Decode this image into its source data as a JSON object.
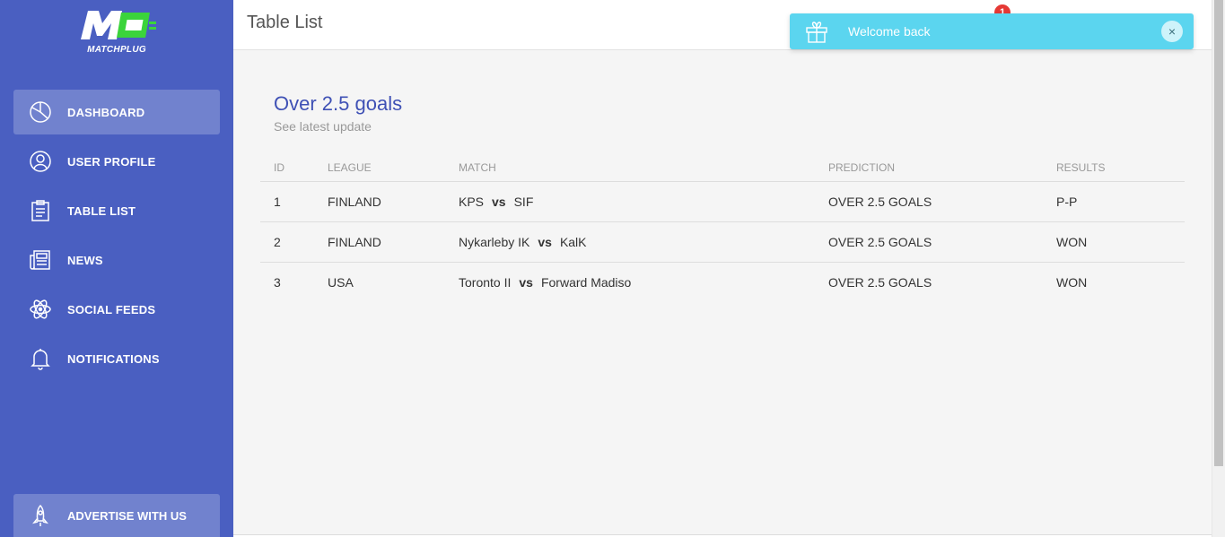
{
  "app": {
    "logo_text": "MATCHPLUG",
    "colors": {
      "sidebar": "#4a5fc1",
      "accent": "#3f51b5",
      "toast": "#5bd5ef",
      "logo_green": "#3bd43b",
      "badge": "#e53935"
    }
  },
  "sidebar": {
    "items": [
      {
        "label": "DASHBOARD",
        "icon": "pie-chart-icon",
        "active": true
      },
      {
        "label": "USER PROFILE",
        "icon": "user-circle-icon",
        "active": false
      },
      {
        "label": "TABLE LIST",
        "icon": "clipboard-icon",
        "active": false
      },
      {
        "label": "NEWS",
        "icon": "newspaper-icon",
        "active": false
      },
      {
        "label": "SOCIAL FEEDS",
        "icon": "atom-icon",
        "active": false
      },
      {
        "label": "NOTIFICATIONS",
        "icon": "bell-icon",
        "active": false
      }
    ],
    "advertise": {
      "label": "ADVERTISE WITH US",
      "icon": "rocket-icon"
    }
  },
  "header": {
    "title": "Table List",
    "notification_count": "1"
  },
  "toast": {
    "message": "Welcome back",
    "icon": "gift-icon",
    "close_symbol": "×"
  },
  "card": {
    "title": "Over 2.5 goals",
    "subtitle": "See latest update",
    "columns": [
      "ID",
      "LEAGUE",
      "MATCH",
      "PREDICTION",
      "RESULTS"
    ],
    "vs_label": "vs",
    "rows": [
      {
        "id": "1",
        "league": "FINLAND",
        "home": "KPS",
        "away": "SIF",
        "prediction": "OVER 2.5 GOALS",
        "result": "P-P"
      },
      {
        "id": "2",
        "league": "FINLAND",
        "home": "Nykarleby IK",
        "away": "KalK",
        "prediction": "OVER 2.5 GOALS",
        "result": "WON"
      },
      {
        "id": "3",
        "league": "USA",
        "home": "Toronto II",
        "away": "Forward Madiso",
        "prediction": "OVER 2.5 GOALS",
        "result": "WON"
      }
    ]
  }
}
